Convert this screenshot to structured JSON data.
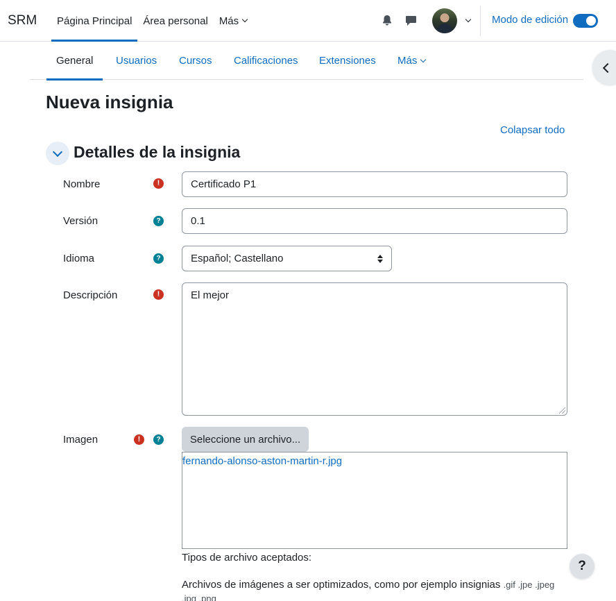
{
  "navbar": {
    "brand": "SRM",
    "primary": [
      "Página Principal",
      "Área personal",
      "Más"
    ],
    "edit_mode_label": "Modo de edición"
  },
  "secondary_nav": [
    "General",
    "Usuarios",
    "Cursos",
    "Calificaciones",
    "Extensiones",
    "Más"
  ],
  "page": {
    "title": "Nueva insignia",
    "collapse_all": "Colapsar todo",
    "section_title": "Detalles de la insignia"
  },
  "form": {
    "name_label": "Nombre",
    "name_value": "Certificado P1",
    "version_label": "Versión",
    "version_value": "0.1",
    "language_label": "Idioma",
    "language_value": "Español; Castellano",
    "description_label": "Descripción",
    "description_value": "El mejor",
    "image_label": "Imagen",
    "file_button": "Seleccione un archivo...",
    "file_name": "fernando-alonso-aston-martin-r.jpg",
    "types_label": "Tipos de archivo aceptados:",
    "types_desc": "Archivos de imágenes a ser optimizados, como por ejemplo insignias",
    "types_ext": ".gif .jpe .jpeg .jpg .png"
  },
  "icons": {
    "required": "!",
    "help": "?",
    "help_fab": "?"
  },
  "colors": {
    "accent": "#0f6cbf",
    "required": "#ca3120",
    "help": "#008196"
  }
}
